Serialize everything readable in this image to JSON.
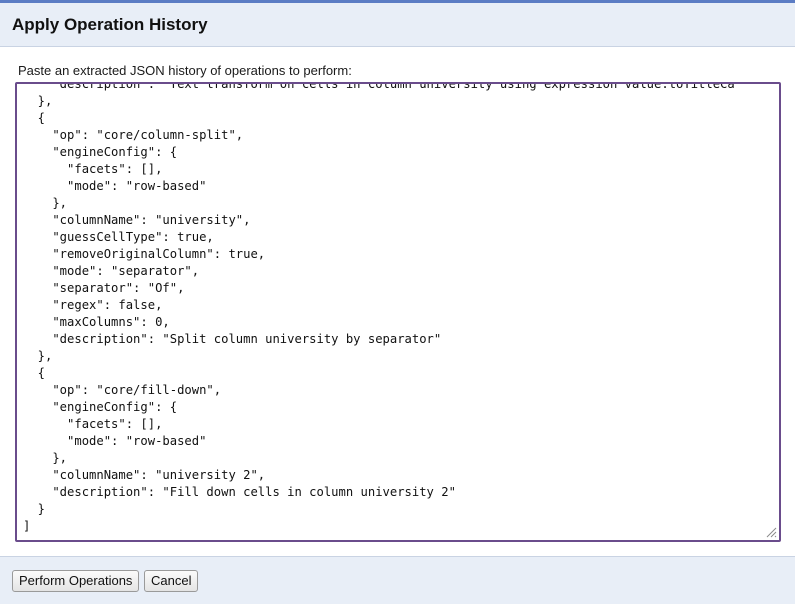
{
  "dialog": {
    "title": "Apply Operation History",
    "instructions": "Paste an extracted JSON history of operations to perform:",
    "json_text": "    \"description\": \"Text transform on cells in column university using expression value.toTitleCa\n  },\n  {\n    \"op\": \"core/column-split\",\n    \"engineConfig\": {\n      \"facets\": [],\n      \"mode\": \"row-based\"\n    },\n    \"columnName\": \"university\",\n    \"guessCellType\": true,\n    \"removeOriginalColumn\": true,\n    \"mode\": \"separator\",\n    \"separator\": \"Of\",\n    \"regex\": false,\n    \"maxColumns\": 0,\n    \"description\": \"Split column university by separator\"\n  },\n  {\n    \"op\": \"core/fill-down\",\n    \"engineConfig\": {\n      \"facets\": [],\n      \"mode\": \"row-based\"\n    },\n    \"columnName\": \"university 2\",\n    \"description\": \"Fill down cells in column university 2\"\n  }\n]"
  },
  "footer": {
    "perform_label": "Perform Operations",
    "cancel_label": "Cancel"
  },
  "colors": {
    "header_bg": "#e8eef7",
    "textarea_border": "#6a4c8c",
    "frame_accent": "#5b7cc4"
  }
}
